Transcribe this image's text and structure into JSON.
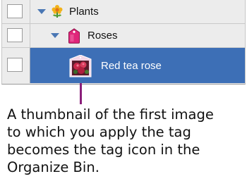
{
  "organize_bin": {
    "rows": [
      {
        "label": "Plants",
        "icon": "flower-icon",
        "expanded": true
      },
      {
        "label": "Roses",
        "icon": "pink-tag-icon",
        "expanded": true
      },
      {
        "label": "Red tea rose",
        "icon": "rose-thumbnail",
        "selected": true
      }
    ],
    "selected_row_color": "#3d6fb6"
  },
  "annotation": {
    "caption_lines": [
      "A thumbnail of the first image",
      "to which you apply the tag",
      "becomes the tag icon in the",
      "Organize Bin."
    ],
    "leader_color": "#8a1f7a"
  }
}
